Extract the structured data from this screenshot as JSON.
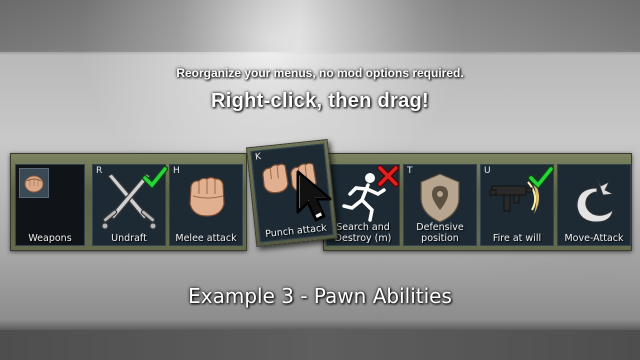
{
  "header": {
    "subtitle": "Reorganize your menus, no mod options required.",
    "title": "Right-click, then drag!"
  },
  "caption": "Example 3 - Pawn Abilities",
  "left_bar": {
    "tiles": [
      {
        "hotkey": "",
        "label": "Weapons",
        "icon": "fist-icon"
      },
      {
        "hotkey": "R",
        "label": "Undraft",
        "icon": "crossed-swords-icon",
        "status": "checkmark-icon"
      },
      {
        "hotkey": "H",
        "label": "Melee attack",
        "icon": "fist-icon"
      }
    ]
  },
  "dragged_tile": {
    "hotkey": "K",
    "label": "Punch attack",
    "icon": "double-fist-icon"
  },
  "right_bar": {
    "tiles": [
      {
        "hotkey": "",
        "label": "Search and\nDestroy (m)",
        "icon": "running-figure-icon",
        "status": "red-x-icon"
      },
      {
        "hotkey": "T",
        "label": "Defensive\nposition",
        "icon": "map-pin-shield-icon"
      },
      {
        "hotkey": "U",
        "label": "Fire at will",
        "icon": "gun-icon",
        "status": "checkmark-icon"
      },
      {
        "hotkey": "",
        "label": "Move-Attack",
        "icon": "swirl-arrow-icon"
      }
    ]
  },
  "colors": {
    "check": "#27d43a",
    "cross": "#e02020",
    "tile_bg": "#1d2a34",
    "bar_bg": "#5c6247"
  }
}
